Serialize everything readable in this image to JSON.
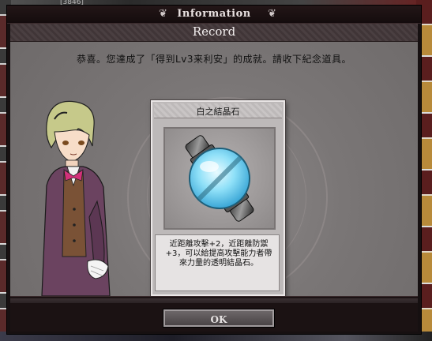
{
  "background": {
    "counter_text": "[3846]"
  },
  "dialog": {
    "title": "Information",
    "subtitle": "Record",
    "message": "恭喜。您達成了「得到Lv3来利安」的成就。請收下紀念道具。",
    "item": {
      "name": "白之結晶石",
      "description": "近距離攻擊+2，近距離防禦+3，可以給提高攻擊能力者帶來力量的透明結晶石。",
      "icon": "crystal-orb-icon"
    },
    "ok_label": "OK"
  },
  "colors": {
    "dialog_bg": "#161011",
    "content_bg": "#7a7676",
    "card_bg": "#bdb9b9",
    "crystal": "#7fd8f5"
  }
}
